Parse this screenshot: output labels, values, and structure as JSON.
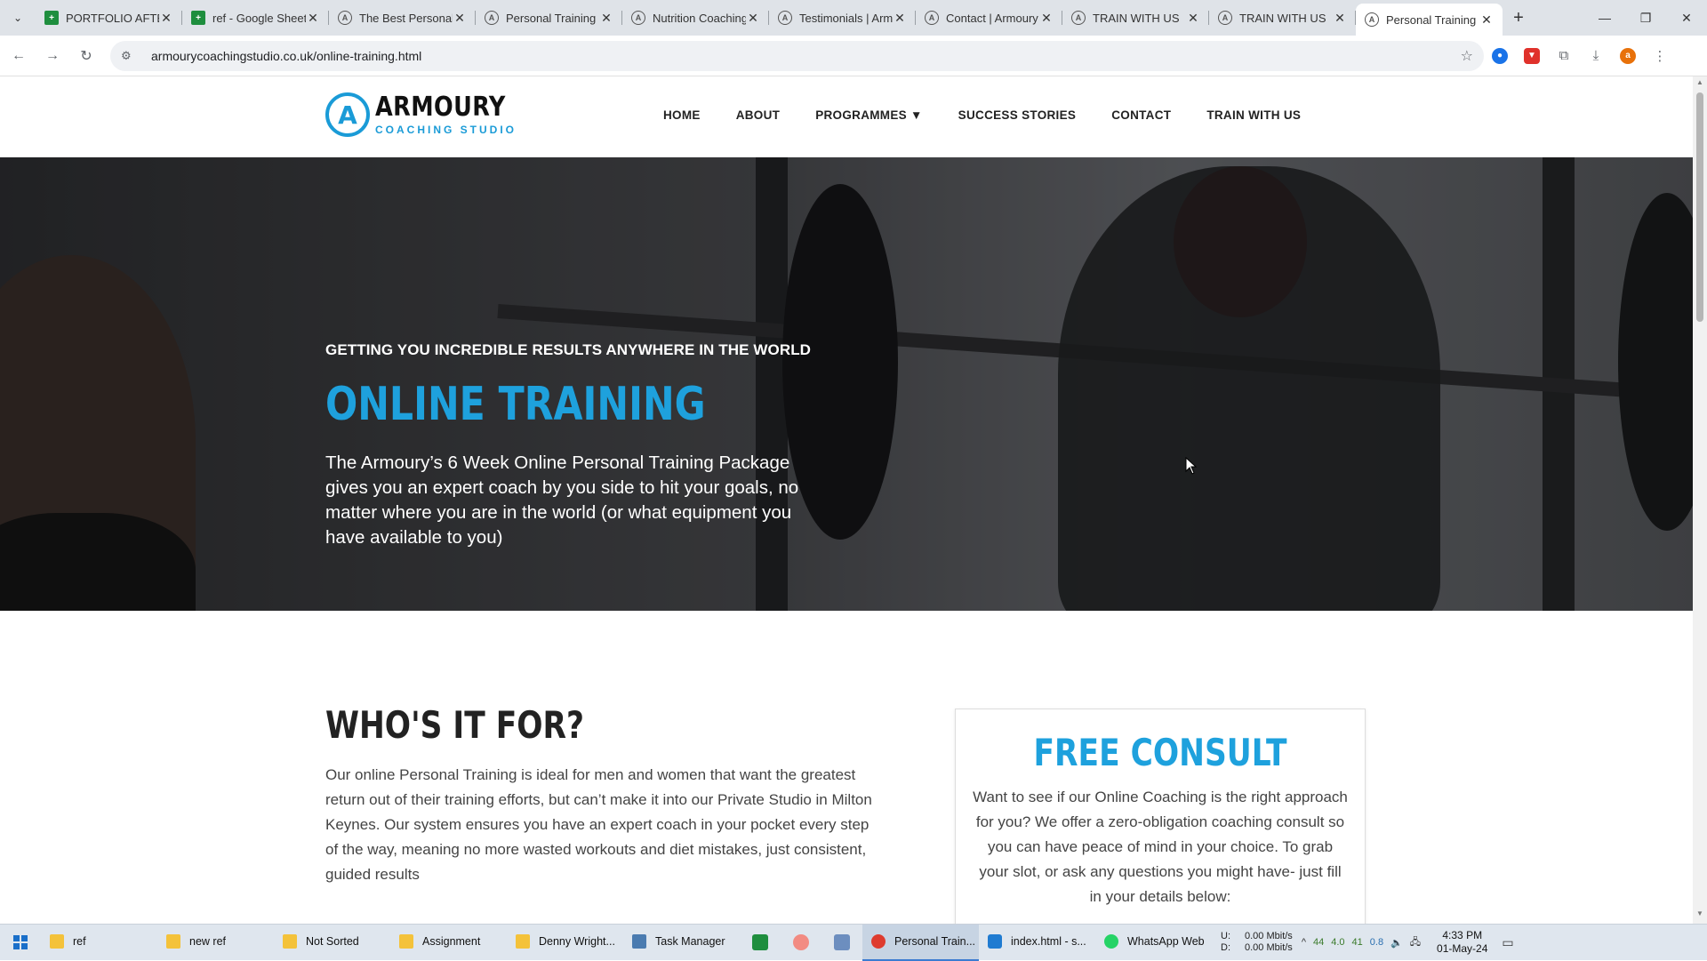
{
  "browser": {
    "tabs": [
      {
        "title": "PORTFOLIO AFTER",
        "icon": "sheets-icon"
      },
      {
        "title": "ref - Google Sheets",
        "icon": "sheets-icon"
      },
      {
        "title": "The Best Personal",
        "icon": "armoury-icon"
      },
      {
        "title": "Personal Training",
        "icon": "armoury-icon"
      },
      {
        "title": "Nutrition Coaching",
        "icon": "armoury-icon"
      },
      {
        "title": "Testimonials | Arm",
        "icon": "armoury-icon"
      },
      {
        "title": "Contact | Armoury",
        "icon": "armoury-icon"
      },
      {
        "title": "TRAIN WITH US",
        "icon": "armoury-icon"
      },
      {
        "title": "TRAIN WITH US",
        "icon": "armoury-icon"
      },
      {
        "title": "Personal Training",
        "icon": "armoury-icon",
        "active": true
      }
    ],
    "url": "armourycoachingstudio.co.uk/online-training.html",
    "profile_initial": "a"
  },
  "site": {
    "logo": {
      "brand": "ARMOURY",
      "sub": "COACHING STUDIO",
      "mark": "A"
    },
    "nav": [
      "HOME",
      "ABOUT",
      "PROGRAMMES ▼",
      "SUCCESS STORIES",
      "CONTACT",
      "TRAIN WITH US"
    ],
    "hero": {
      "kicker": "GETTING YOU INCREDIBLE RESULTS ANYWHERE IN THE WORLD",
      "title": "ONLINE TRAINING",
      "lead": "The Armoury’s 6 Week Online Personal Training Package gives you an expert coach by you side to hit your goals, no matter where you are in the world (or what equipment you have available to you)"
    },
    "who": {
      "heading": "WHO'S IT FOR?",
      "body": "Our online Personal Training is ideal for men and women that want the greatest return out of their training efforts, but can’t make it into our Private Studio in Milton Keynes. Our system ensures you have an expert coach in your pocket every step of the way, meaning no more wasted workouts and diet mistakes, just consistent, guided results"
    },
    "consult": {
      "heading": "FREE CONSULT",
      "body": "Want to see if our Online Coaching is the right approach for you? We offer a zero-obligation coaching consult so you can have peace of mind in your choice. To grab your slot, or ask any questions you might have- just fill in your details below:"
    }
  },
  "taskbar": {
    "items": [
      {
        "label": "ref",
        "icon": "folder-icon"
      },
      {
        "label": "new ref",
        "icon": "folder-icon"
      },
      {
        "label": "Not Sorted",
        "icon": "folder-icon"
      },
      {
        "label": "Assignment",
        "icon": "folder-icon"
      },
      {
        "label": "Denny Wright...",
        "icon": "folder-icon"
      },
      {
        "label": "Task Manager",
        "icon": "task-manager-icon"
      }
    ],
    "items2": [
      {
        "label": "Personal Train...",
        "icon": "chrome-icon",
        "active": true
      },
      {
        "label": "index.html - s...",
        "icon": "vscode-icon"
      },
      {
        "label": "WhatsApp Web",
        "icon": "whatsapp-icon"
      }
    ],
    "net": {
      "u_label": "U:",
      "d_label": "D:",
      "u": "0.00 Mbit/s",
      "d": "0.00 Mbit/s"
    },
    "tray": [
      "44",
      "4.0",
      "41",
      "0.8"
    ],
    "time": "4:33 PM",
    "date": "01-May-24"
  },
  "colors": {
    "accent": "#1ea1dd",
    "dark": "#222222"
  }
}
